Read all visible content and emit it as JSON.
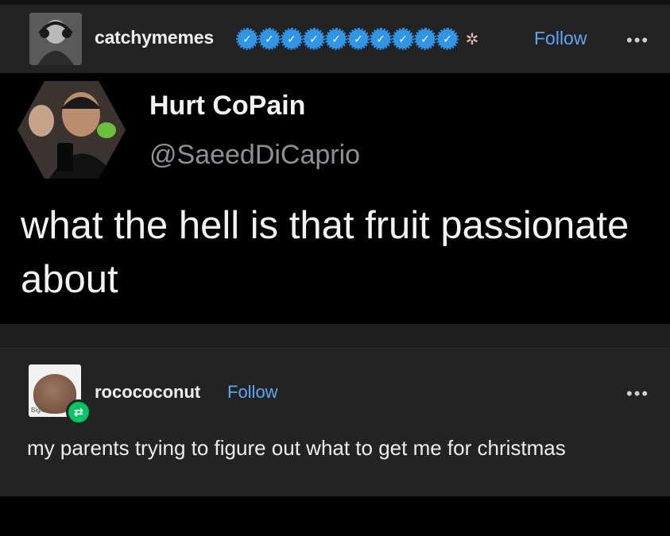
{
  "post": {
    "username": "catchymemes",
    "badge_count": 10,
    "badge_icon": "verified-check-icon",
    "extra_icon": "crab-icon",
    "follow_label": "Follow",
    "more_label": "•••"
  },
  "tweet": {
    "display_name": "Hurt CoPain",
    "handle": "@SaeedDiCaprio",
    "text": "what the hell is that fruit passionate about"
  },
  "reblog": {
    "username": "rocococonut",
    "follow_label": "Follow",
    "more_label": "•••",
    "avatar_caption": "Biglet",
    "text": "my parents trying to figure out what to get me for christmas"
  },
  "colors": {
    "accent": "#59a8f5",
    "badge": "#2f95e6",
    "reblog_green": "#01c463",
    "panel": "#232323",
    "tweet_bg": "#000000"
  }
}
